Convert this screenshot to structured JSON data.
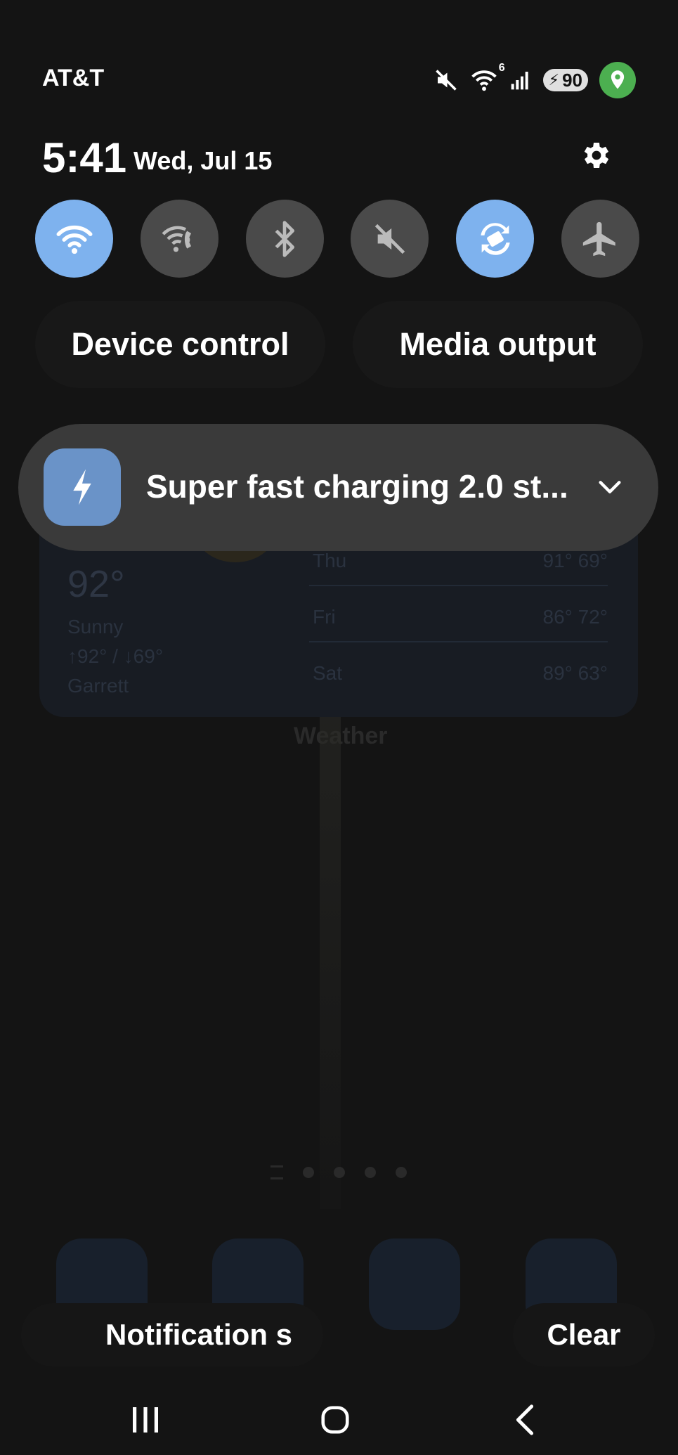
{
  "status_bar": {
    "carrier": "AT&T",
    "wifi_badge": "6",
    "battery_level": "90",
    "icons": [
      "mute-icon",
      "wifi-icon",
      "signal-icon",
      "battery-charging-icon",
      "location-icon"
    ]
  },
  "header": {
    "time": "5:41",
    "date": "Wed, Jul 15"
  },
  "quick_toggles": [
    {
      "name": "wifi",
      "icon": "wifi-icon",
      "on": true
    },
    {
      "name": "wifi-calling",
      "icon": "wifi-calling-icon",
      "on": false
    },
    {
      "name": "bluetooth",
      "icon": "bluetooth-icon",
      "on": false
    },
    {
      "name": "sound",
      "icon": "mute-icon",
      "on": false
    },
    {
      "name": "auto-rotate",
      "icon": "auto-rotate-icon",
      "on": true
    },
    {
      "name": "airplane-mode",
      "icon": "airplane-icon",
      "on": false
    }
  ],
  "controls": {
    "device_control": "Device control",
    "media_output": "Media output"
  },
  "notification": {
    "text": "Super fast charging 2.0 st...",
    "icon": "lightning-icon"
  },
  "background_widget": {
    "temp": "92°",
    "condition": "Sunny",
    "range": "↑92° / ↓69°",
    "location": "Garrett",
    "forecast": [
      {
        "day": "Thu",
        "temps": "91° 69°"
      },
      {
        "day": "Fri",
        "temps": "86° 72°"
      },
      {
        "day": "Sat",
        "temps": "89° 63°"
      }
    ],
    "title": "Weather"
  },
  "footer": {
    "notification_settings": "Notification s",
    "clear": "Clear"
  },
  "colors": {
    "toggle_on": "#7eb2ee",
    "toggle_off": "#4a4a4a",
    "notification_icon_bg": "#6a93c8",
    "location_green": "#4caf50"
  }
}
